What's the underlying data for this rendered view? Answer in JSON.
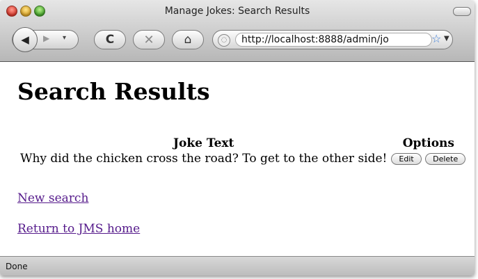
{
  "window": {
    "title": "Manage Jokes: Search Results",
    "url": "http://localhost:8888/admin/jo"
  },
  "toolbar": {
    "back_icon": "◀",
    "forward_icon": "▶",
    "dropdown_icon": "▾",
    "reload_icon": "C",
    "stop_icon": "✕",
    "home_icon": "⌂",
    "bookmark_icon": "☆",
    "url_dropdown_icon": "▼"
  },
  "page": {
    "heading": "Search Results",
    "table": {
      "headers": [
        "Joke Text",
        "Options"
      ],
      "rows": [
        {
          "joke": "Why did the chicken cross the road? To get to the other side!",
          "edit_label": "Edit",
          "delete_label": "Delete"
        }
      ]
    },
    "links": {
      "new_search": "New search",
      "return_home": "Return to JMS home"
    }
  },
  "status": {
    "text": "Done"
  }
}
